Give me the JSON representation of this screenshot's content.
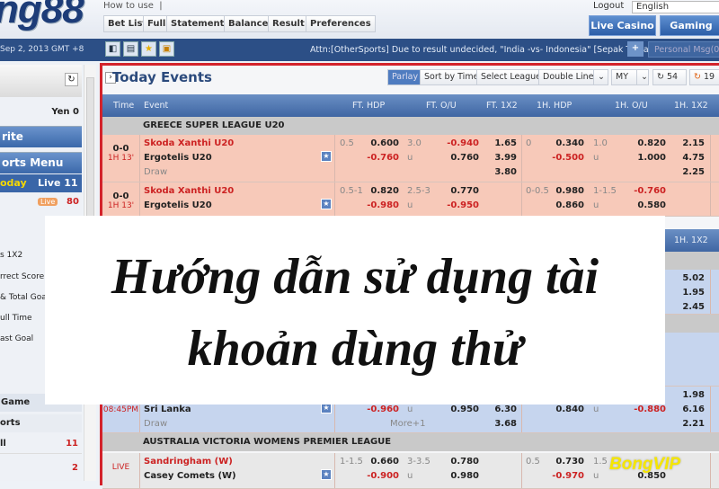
{
  "header": {
    "logo": "ng88",
    "how_to_use": "How to use  |",
    "logout": "Logout",
    "language": "English",
    "tabs": [
      "Bet List",
      "Full",
      "Statement",
      "Balance",
      "Result",
      "Preferences"
    ],
    "live_casino": "Live Casino",
    "gaming": "Gaming"
  },
  "bar": {
    "date": "Sep 2, 2013 GMT +8",
    "icons": [
      "collapse-icon",
      "print-icon",
      "favorite-star-icon",
      "tv-icon"
    ],
    "notice": "Attn:[OtherSports] Due to result undecided, \"India -vs- Indonesia\" [Sepak Takraw",
    "plus": "+",
    "personal_msg": "Personal Msg(0)"
  },
  "sidebar": {
    "balance": "Yen 0",
    "favorite": "rite",
    "sports_menu": "orts Menu",
    "today": "oday",
    "live": "Live 11",
    "live_badge": "Live",
    "live_count": "80",
    "menu": [
      "s 1X2",
      "rrect Score",
      "& Total Goal",
      "ull Time",
      "ast Goal"
    ],
    "game": "Game",
    "sports": "orts",
    "all": "ll",
    "all_count": "11",
    "other_count": "2"
  },
  "main": {
    "title": "Today Events",
    "toolbar": [
      "Parlay",
      "Sort by Time",
      "Select League",
      "Double Line",
      "MY"
    ],
    "refresh1": "54",
    "refresh2": "19",
    "columns": [
      "Time",
      "Event",
      "FT. HDP",
      "FT. O/U",
      "FT. 1X2",
      "1H. HDP",
      "1H. O/U",
      "1H. 1X2"
    ],
    "leagues": [
      "GREECE SUPER LEAGUE U20",
      "AUSTRALIA VICTORIA WOMENS PREMIER LEAGUE"
    ],
    "rows": [
      {
        "time": [
          "0-0",
          "1H 13'"
        ],
        "teams": [
          "Skoda Xanthi U20",
          "Ergotelis U20",
          "Draw"
        ],
        "ft_hdp": {
          "line": "0.5",
          "odds": [
            "0.600",
            "-0.760"
          ]
        },
        "ft_ou": {
          "line": "3.0",
          "u": "u",
          "odds": [
            "-0.940",
            "0.760"
          ]
        },
        "ft_1x2": [
          "1.65",
          "3.99",
          "3.80"
        ],
        "h1_hdp": {
          "line": "0",
          "odds": [
            "0.340",
            "-0.500"
          ]
        },
        "h1_ou": {
          "line": "1.0",
          "u": "u",
          "odds": [
            "0.820",
            "1.000"
          ]
        },
        "h1_1x2": [
          "2.15",
          "4.75",
          "2.25"
        ]
      },
      {
        "time": [
          "0-0",
          "1H 13'"
        ],
        "teams": [
          "Skoda Xanthi U20",
          "Ergotelis U20",
          ""
        ],
        "ft_hdp": {
          "line": "0.5-1",
          "odds": [
            "0.820",
            "-0.980"
          ]
        },
        "ft_ou": {
          "line": "2.5-3",
          "u": "u",
          "odds": [
            "0.770",
            "-0.950"
          ]
        },
        "ft_1x2": [
          "",
          "",
          ""
        ],
        "h1_hdp": {
          "line": "0-0.5",
          "odds": [
            "0.980",
            "0.860"
          ]
        },
        "h1_ou": {
          "line": "1-1.5",
          "u": "u",
          "odds": [
            "-0.760",
            "0.580"
          ]
        },
        "h1_1x2": [
          "",
          "",
          ""
        ]
      },
      {
        "h1_1x2": [
          "5.02",
          "1.95",
          "2.45"
        ]
      },
      {
        "time": [
          "",
          "08:45PM"
        ],
        "teams": [
          "",
          "Sri Lanka",
          "Draw"
        ],
        "ft_hdp": {
          "line": "",
          "odds": [
            "",
            "-0.960"
          ]
        },
        "ft_ou": {
          "line": "",
          "u": "u",
          "odds": [
            "",
            "0.950"
          ]
        },
        "ft_1x2": [
          "",
          "6.30",
          "3.68"
        ],
        "more": "More+1",
        "h1_hdp": {
          "line": "",
          "odds": [
            "",
            "0.840"
          ]
        },
        "h1_ou": {
          "line": "",
          "u": "u",
          "odds": [
            "",
            "-0.880"
          ]
        },
        "h1_1x2": [
          "1.98",
          "6.16",
          "2.21"
        ]
      },
      {
        "time": [
          "LIVE",
          ""
        ],
        "teams": [
          "Sandringham (W)",
          "Casey Comets (W)",
          ""
        ],
        "ft_hdp": {
          "line": "1-1.5",
          "odds": [
            "0.660",
            "-0.900"
          ]
        },
        "ft_ou": {
          "line": "3-3.5",
          "u": "u",
          "odds": [
            "0.780",
            "0.980"
          ]
        },
        "ft_1x2": [
          "",
          "",
          ""
        ],
        "h1_hdp": {
          "line": "0.5",
          "odds": [
            "0.730",
            "-0.970"
          ]
        },
        "h1_ou": {
          "line": "1.5",
          "u": "u",
          "odds": [
            "",
            "0.850"
          ]
        },
        "h1_1x2": [
          "",
          "",
          ""
        ]
      }
    ]
  },
  "overlay": {
    "line1": "Hướng dẫn sử dụng tài",
    "line2": "khoản dùng thử"
  },
  "watermark": "BongVIP"
}
